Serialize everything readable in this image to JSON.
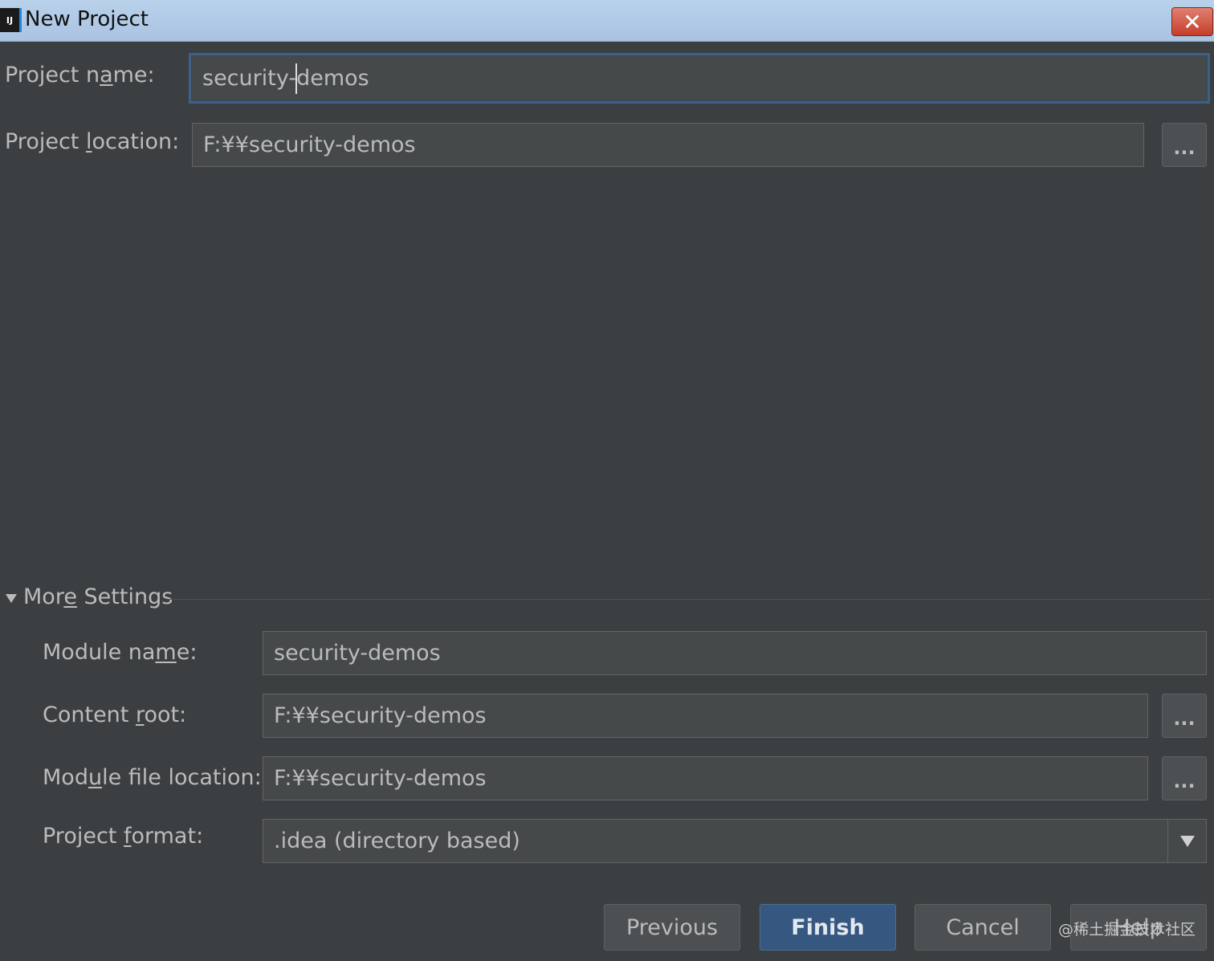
{
  "window": {
    "title": "New Project",
    "app_icon": "IJ",
    "close_glyph": "✕"
  },
  "project": {
    "name_label_pre": "Project n",
    "name_label_mn": "a",
    "name_label_post": "me:",
    "name_value_before_caret": "security-",
    "name_value_after_caret": "demos",
    "location_label_pre": "Project ",
    "location_label_mn": "l",
    "location_label_post": "ocation:",
    "location_value": "F:¥¥security-demos",
    "browse_label": "..."
  },
  "more_settings": {
    "label_pre": "Mor",
    "label_mn": "e",
    "label_post": " Settings",
    "module_name_label_pre": "Module na",
    "module_name_label_mn": "m",
    "module_name_label_post": "e:",
    "module_name_value": "security-demos",
    "content_root_label_pre": "Content ",
    "content_root_label_mn": "r",
    "content_root_label_post": "oot:",
    "content_root_value": "F:¥¥security-demos",
    "module_file_label_pre": "Mod",
    "module_file_label_mn": "u",
    "module_file_label_post": "le file location:",
    "module_file_value": "F:¥¥security-demos",
    "project_format_label_pre": "Project ",
    "project_format_label_mn": "f",
    "project_format_label_post": "ormat:",
    "project_format_value": ".idea (directory based)",
    "browse_label": "..."
  },
  "buttons": {
    "previous": "Previous",
    "finish": "Finish",
    "cancel": "Cancel",
    "help": "Help"
  },
  "watermark": "@稀土掘金技术社区",
  "colors": {
    "background": "#3c3f41",
    "field": "#45494a",
    "focus_border": "#3d6185",
    "primary_button": "#365880"
  }
}
